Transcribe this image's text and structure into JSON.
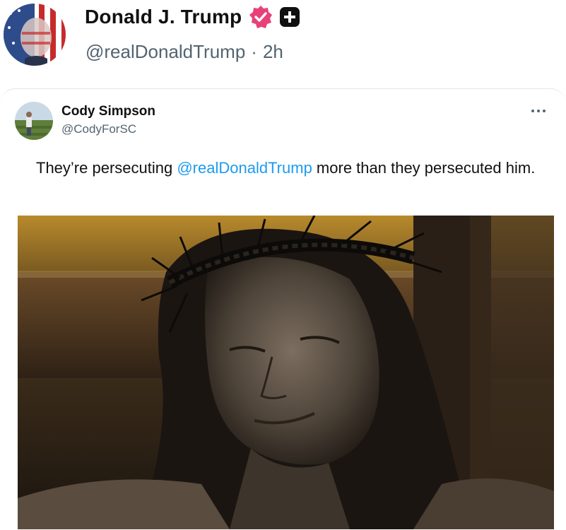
{
  "post": {
    "author_name": "Donald J. Trump",
    "handle": "@realDonaldTrump",
    "separator": "·",
    "time": "2h",
    "verified_icon": "verified-badge-icon",
    "badge_icon": "plus-badge-icon"
  },
  "quote": {
    "author_name": "Cody Simpson",
    "handle": "@CodyForSC",
    "text_before": "They’re persecuting ",
    "mention": "@realDonaldTrump",
    "text_after": " more than they persecuted him.",
    "more_icon": "more-options-icon"
  },
  "colors": {
    "mention": "#1d9bf0",
    "verified": "#e8417a",
    "secondary_text": "#536471"
  }
}
